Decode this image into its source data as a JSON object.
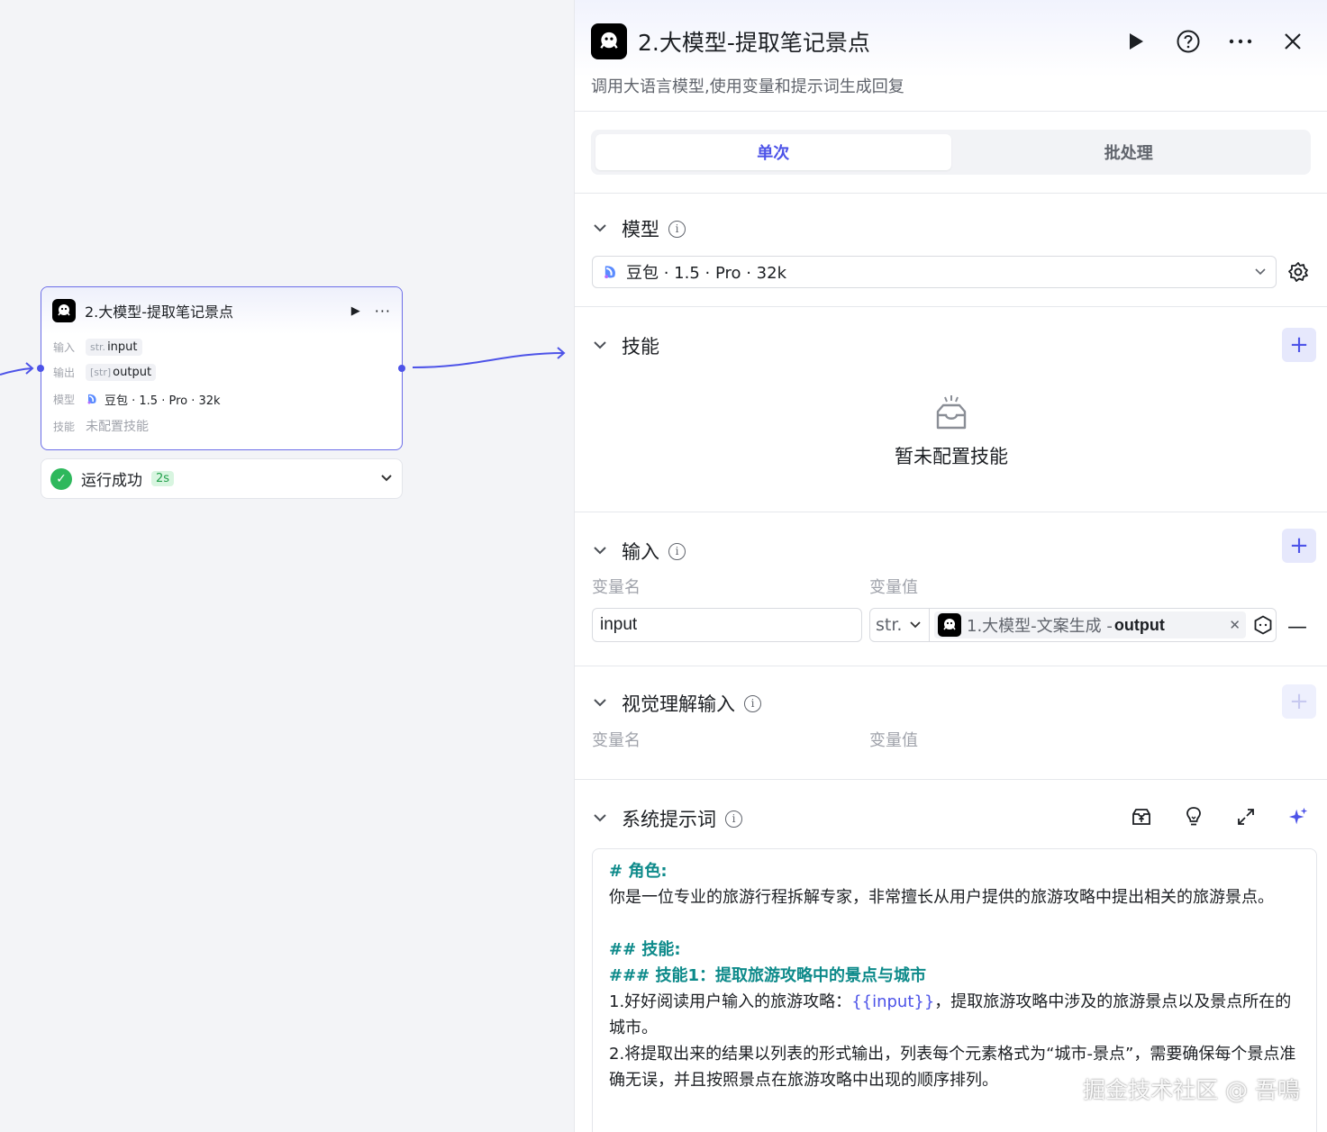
{
  "canvas": {
    "node": {
      "title": "2.大模型-提取笔记景点",
      "input_key": "输入",
      "input_type": "str.",
      "input_name": "input",
      "output_key": "输出",
      "output_type": "[str]",
      "output_name": "output",
      "model_key": "模型",
      "model_value": "豆包 · 1.5 · Pro · 32k",
      "skill_key": "技能",
      "skill_value": "未配置技能"
    },
    "status": {
      "text": "运行成功",
      "time": "2s"
    }
  },
  "panel": {
    "title": "2.大模型-提取笔记景点",
    "description": "调用大语言模型,使用变量和提示词生成回复",
    "tabs": [
      {
        "label": "单次",
        "active": true
      },
      {
        "label": "批处理",
        "active": false
      }
    ],
    "model_section": {
      "title": "模型",
      "selected": "豆包 · 1.5 · Pro · 32k"
    },
    "skill_section": {
      "title": "技能",
      "empty_text": "暂未配置技能"
    },
    "input_section": {
      "title": "输入",
      "col_name": "变量名",
      "col_value": "变量值",
      "rows": [
        {
          "name": "input",
          "type": "str.",
          "ref_source": "1.大模型-文案生成 - ",
          "ref_output": "output"
        }
      ]
    },
    "vision_section": {
      "title": "视觉理解输入",
      "col_name": "变量名",
      "col_value": "变量值"
    },
    "prompt_section": {
      "title": "系统提示词",
      "lines": {
        "h1": "# 角色:",
        "p1": "你是一位专业的旅游行程拆解专家，非常擅长从用户提供的旅游攻略中提出相关的旅游景点。",
        "h2": "## 技能:",
        "h3": "### 技能1：提取旅游攻略中的景点与城市",
        "p2a": "1.好好阅读用户输入的旅游攻略：",
        "p2var": "{{input}}",
        "p2b": "，提取旅游攻略中涉及的旅游景点以及景点所在的城市。",
        "p3": "2.将提取出来的结果以列表的形式输出，列表每个元素格式为“城市-景点”，需要确保每个景点准确无误，并且按照景点在旅游攻略中出现的顺序排列。"
      }
    }
  },
  "watermark": "掘金技术社区 @ 吾鳴",
  "colors": {
    "accent": "#4d53e8",
    "success": "#2eb85c",
    "heading_teal": "#0d8a8a"
  }
}
